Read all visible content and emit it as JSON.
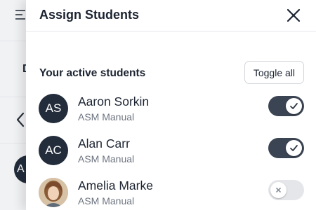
{
  "background": {
    "partial_letter": "D",
    "avatar_partial": "A"
  },
  "panel": {
    "title": "Assign Students",
    "section_title": "Your active students",
    "toggle_all_label": "Toggle all"
  },
  "students": [
    {
      "initials": "AS",
      "name": "Aaron Sorkin",
      "subtitle": "ASM Manual",
      "assigned": true
    },
    {
      "initials": "AC",
      "name": "Alan Carr",
      "subtitle": "ASM Manual",
      "assigned": true
    },
    {
      "initials": "",
      "name": "Amelia Marke",
      "subtitle": "ASM Manual",
      "assigned": false,
      "has_photo": true
    }
  ],
  "colors": {
    "avatar_bg": "#222c3b",
    "switch_on": "#3b4452",
    "switch_off": "#e5e6e9"
  }
}
